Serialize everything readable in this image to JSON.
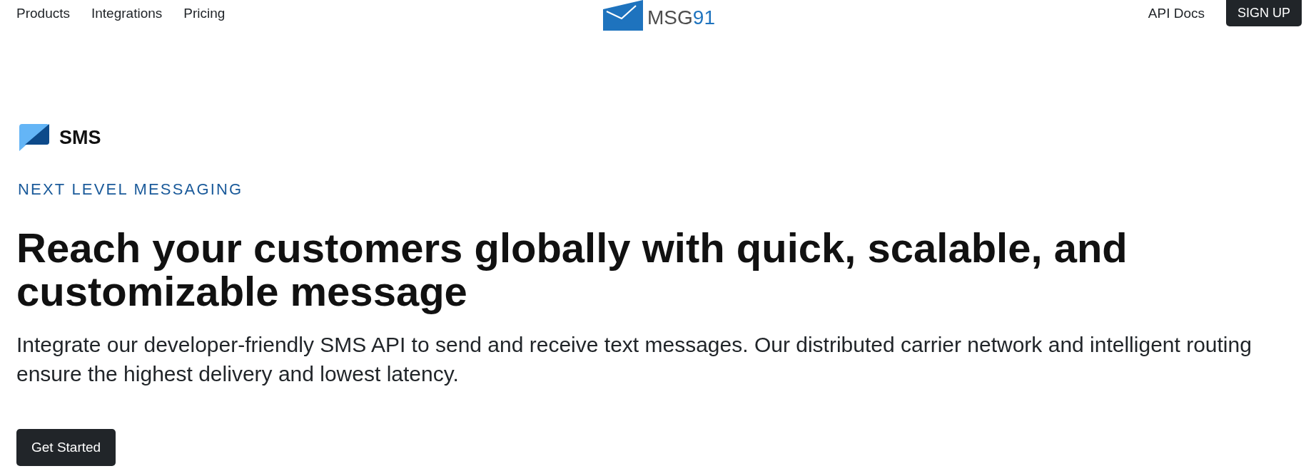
{
  "header": {
    "nav_links": [
      "Products",
      "Integrations",
      "Pricing"
    ],
    "logo": {
      "text": "MSG",
      "accent": "91"
    },
    "right_links": [
      "API Docs"
    ],
    "signup_button": "SIGN UP"
  },
  "product": {
    "name": "SMS"
  },
  "hero": {
    "eyebrow": "NEXT LEVEL MESSAGING",
    "heading": "Reach your customers globally with quick, scalable, and customizable message",
    "description": "Integrate our developer-friendly SMS API to send and receive text messages. Our distributed carrier network and intelligent routing ensure the highest delivery and lowest latency.",
    "cta_button": "Get Started"
  }
}
